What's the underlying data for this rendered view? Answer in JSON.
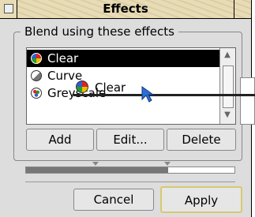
{
  "window": {
    "title": "Effects"
  },
  "group": {
    "label": "Blend using these effects"
  },
  "effects_list": {
    "items": [
      {
        "label": "Clear",
        "icon": "rainbow-circle-icon",
        "selected": true
      },
      {
        "label": "Curve",
        "icon": "grey-half-circle-icon",
        "selected": false
      },
      {
        "label": "Greyscale",
        "icon": "rgb-dots-circle-icon",
        "selected": false
      }
    ]
  },
  "buttons": {
    "add": "Add",
    "edit": "Edit...",
    "delete": "Delete",
    "cancel": "Cancel",
    "apply": "Apply"
  },
  "slider": {
    "fill_fraction": 0.68
  },
  "drag": {
    "label": "Clear",
    "icon": "rainbow-circle-icon"
  },
  "colors": {
    "title_bar": "#e8dcb6",
    "selection": "#000000",
    "slider_fill": "#777777",
    "pointer": "#2a6fd6",
    "apply_border": "#d8c870"
  }
}
